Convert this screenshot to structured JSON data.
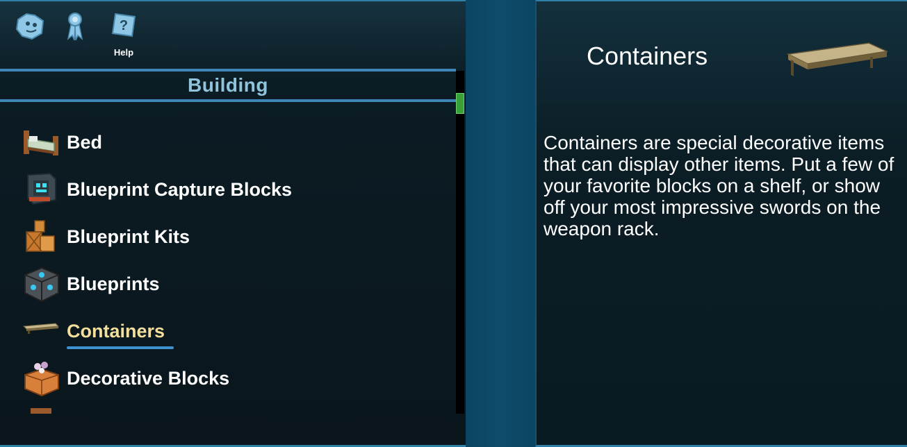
{
  "toolbar": {
    "icons": [
      "skin-icon",
      "ribbon-icon",
      "help-icon"
    ],
    "help_label": "Help"
  },
  "category": {
    "title": "Building"
  },
  "items": [
    {
      "label": "Bed",
      "icon": "bed-icon",
      "selected": false
    },
    {
      "label": "Blueprint Capture Blocks",
      "icon": "capture-block-icon",
      "selected": false
    },
    {
      "label": "Blueprint Kits",
      "icon": "kit-icon",
      "selected": false
    },
    {
      "label": "Blueprints",
      "icon": "blueprint-cube-icon",
      "selected": false
    },
    {
      "label": "Containers",
      "icon": "shelf-icon",
      "selected": true
    },
    {
      "label": "Decorative Blocks",
      "icon": "decorative-block-icon",
      "selected": false
    }
  ],
  "detail": {
    "title": "Containers",
    "icon": "shelf-icon",
    "description": "Containers are special decorative items that can display other items. Put a few of your favorite blocks on a shelf, or show off your most impressive swords on the weapon rack."
  },
  "colors": {
    "accent": "#3e86b8",
    "selected_text": "#f3de9c",
    "header_text": "#8fc4dc",
    "scroll_thumb": "#3aa13a"
  }
}
